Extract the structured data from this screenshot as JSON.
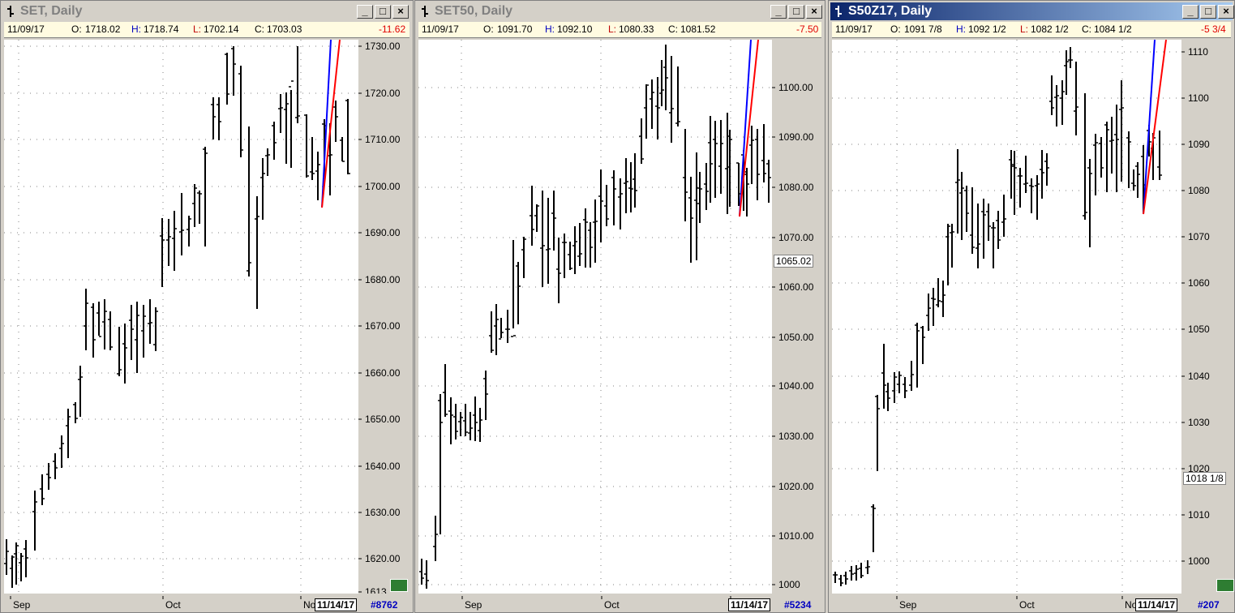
{
  "windows": [
    {
      "title": "SET, Daily",
      "active": false,
      "info": {
        "date": "11/09/17",
        "o_label": "O:",
        "o": "1718.02",
        "h_label": "H:",
        "h": "1718.74",
        "l_label": "L:",
        "l": "1702.14",
        "c_label": "C:",
        "c": "1703.03",
        "change": "-11.62"
      },
      "y_ticks": [
        "1730.00",
        "1720.00",
        "1710.00",
        "1700.00",
        "1690.00",
        "1680.00",
        "1670.00",
        "1660.00",
        "1650.00",
        "1640.00",
        "1630.00",
        "1620.00",
        "1613"
      ],
      "x_labels": [
        "Sep",
        "Oct",
        "No"
      ],
      "date_box": "11/14/17",
      "bar_count": "#8762",
      "price_tag": ""
    },
    {
      "title": "SET50, Daily",
      "active": false,
      "info": {
        "date": "11/09/17",
        "o_label": "O:",
        "o": "1091.70",
        "h_label": "H:",
        "h": "1092.10",
        "l_label": "L:",
        "l": "1080.33",
        "c_label": "C:",
        "c": "1081.52",
        "change": "-7.50"
      },
      "y_ticks": [
        "1100.00",
        "1090.00",
        "1080.00",
        "1070.00",
        "1060.00",
        "1050.00",
        "1040.00",
        "1030.00",
        "1020.00",
        "1010.00",
        "1000"
      ],
      "x_labels": [
        "Sep",
        "Oct",
        "N"
      ],
      "date_box": "11/14/17",
      "bar_count": "#5234",
      "price_tag": "1065.02"
    },
    {
      "title": "S50Z17, Daily",
      "active": true,
      "info": {
        "date": "11/09/17",
        "o_label": "O:",
        "o": "1091 7/8",
        "h_label": "H:",
        "h": "1092 1/2",
        "l_label": "L:",
        "l": "1082 1/2",
        "c_label": "C:",
        "c": "1084 1/2",
        "change": "-5 3/4"
      },
      "y_ticks": [
        "1110",
        "1100",
        "1090",
        "1080",
        "1070",
        "1060",
        "1050",
        "1040",
        "1030",
        "1020",
        "1010",
        "1000"
      ],
      "x_labels": [
        "Sep",
        "Oct",
        "No"
      ],
      "date_box": "11/14/17",
      "bar_count": "#207",
      "price_tag": "1018 1/8"
    }
  ],
  "window_buttons": {
    "minimize": "_",
    "maximize": "□",
    "close": "×"
  },
  "colors": {
    "blue_line": "#0000ff",
    "red_line": "#ff0000",
    "bars": "#000000",
    "grid": "#808080"
  }
}
